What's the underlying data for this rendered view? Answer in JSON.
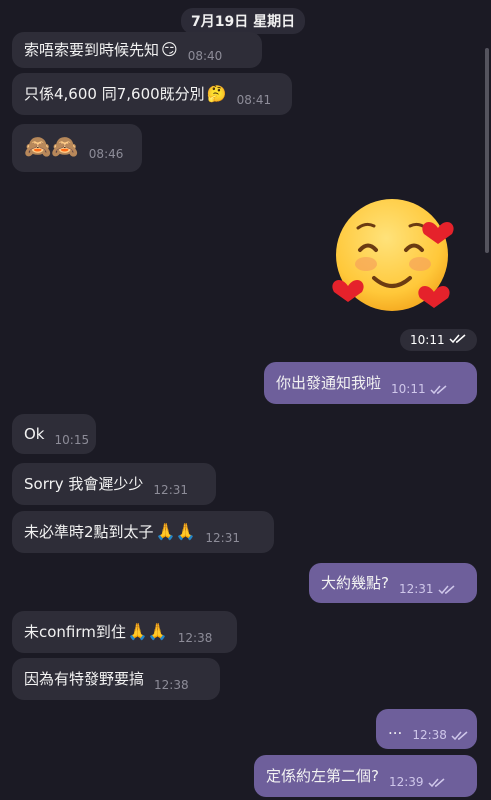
{
  "date_header": "7月19日 星期日",
  "messages": [
    {
      "text": "索唔索要到時候先知",
      "emoji": "😏",
      "time": "08:40"
    },
    {
      "text": "只係4,600 同7,600既分別",
      "emoji": "🤔",
      "time": "08:41"
    },
    {
      "text": "🙈🙈",
      "time": "08:46"
    },
    {
      "sticker": "☺",
      "time": "10:11"
    },
    {
      "text": "你出發通知我啦",
      "time": "10:11"
    },
    {
      "text": "Ok",
      "time": "10:15"
    },
    {
      "text": "Sorry 我會遲少少",
      "time": "12:31"
    },
    {
      "text": "未必準時2點到太子",
      "emoji": "🙏🙏",
      "time": "12:31"
    },
    {
      "text": "大約幾點?",
      "time": "12:31"
    },
    {
      "text": "未confirm到住",
      "emoji": "🙏🙏",
      "time": "12:38"
    },
    {
      "text": "因為有特發野要搞",
      "time": "12:38"
    },
    {
      "text": "...",
      "time": "12:38"
    },
    {
      "text": "定係約左第二個?",
      "time": "12:39"
    }
  ],
  "colors": {
    "background": "#1b1a24",
    "incoming_bubble": "#2e2d38",
    "outgoing_bubble": "#6e5f9b"
  }
}
